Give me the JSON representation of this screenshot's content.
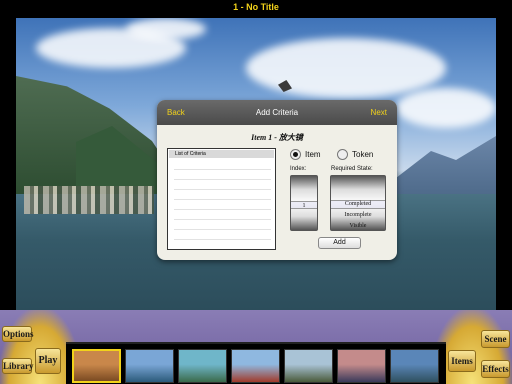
{
  "titlebar": {
    "title": "1 - No Title"
  },
  "dialog": {
    "back_label": "Back",
    "title": "Add Criteria",
    "next_label": "Next",
    "item_title": "Item 1 - 放大镜",
    "list_header": "List of Criteria",
    "radio_item_label": "Item",
    "radio_token_label": "Token",
    "radio_selected": "Item",
    "index_label": "Index:",
    "index_value": "1",
    "state_label": "Required State:",
    "state_options": [
      "Completed",
      "Incomplete",
      "Visible"
    ],
    "state_selected": "Completed",
    "add_label": "Add"
  },
  "bottombar": {
    "options_label": "Options",
    "library_label": "Library",
    "play_label": "Play",
    "items_label": "Items",
    "scene_label": "Scene",
    "effects_label": "Effects",
    "thumbnails": [
      {
        "name": "wooden-room",
        "selected": true,
        "colors": [
          "#c9874a",
          "#7a4a22"
        ]
      },
      {
        "name": "island-cliff",
        "selected": false,
        "colors": [
          "#7aa6d6",
          "#2b5a7a"
        ]
      },
      {
        "name": "beach-cove",
        "selected": false,
        "colors": [
          "#6fb6c9",
          "#3a6a4a"
        ]
      },
      {
        "name": "temple",
        "selected": false,
        "colors": [
          "#8fb8e0",
          "#a03a2a"
        ]
      },
      {
        "name": "mountain-ruins",
        "selected": false,
        "colors": [
          "#a9c3d6",
          "#4a5a3a"
        ]
      },
      {
        "name": "city-dusk",
        "selected": false,
        "colors": [
          "#c48b8b",
          "#3a3a5a"
        ]
      },
      {
        "name": "lake-mountains",
        "selected": false,
        "colors": [
          "#5a86b8",
          "#2f5060"
        ]
      }
    ]
  }
}
